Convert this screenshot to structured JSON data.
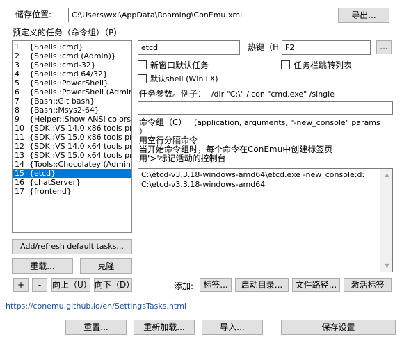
{
  "storage": {
    "label": "储存位置:",
    "path": "C:\\Users\\wxl\\AppData\\Roaming\\ConEmu.xml",
    "export_button": "导出..."
  },
  "tasks_group_label": "预定义的任务（命令组）（P）",
  "task_list": [
    {
      "num": "1",
      "name": "{Shells::cmd}"
    },
    {
      "num": "2",
      "name": "{Shells::cmd (Admin)}"
    },
    {
      "num": "3",
      "name": "{Shells::cmd-32}"
    },
    {
      "num": "4",
      "name": "{Shells::cmd 64/32}"
    },
    {
      "num": "5",
      "name": "{Shells::PowerShell}"
    },
    {
      "num": "6",
      "name": "{Shells::PowerShell (Admin)}"
    },
    {
      "num": "7",
      "name": "{Bash::Git bash}"
    },
    {
      "num": "8",
      "name": "{Bash::Msys2-64}"
    },
    {
      "num": "9",
      "name": "{Helper::Show ANSI colors}"
    },
    {
      "num": "10",
      "name": "{SDK::VS 14.0 x86 tools prompt}"
    },
    {
      "num": "11",
      "name": "{SDK::VS 15.0 x86 tools prompt}"
    },
    {
      "num": "12",
      "name": "{SDK::VS 14.0 x64 tools prompt}"
    },
    {
      "num": "13",
      "name": "{SDK::VS 15.0 x64 tools prompt}"
    },
    {
      "num": "14",
      "name": "{Tools::Chocolatey (Admin)}"
    },
    {
      "num": "15",
      "name": "{etcd}",
      "selected": true
    },
    {
      "num": "16",
      "name": "{chatServer}"
    },
    {
      "num": "17",
      "name": "{frontend}"
    }
  ],
  "left_buttons": {
    "add_refresh": "Add/refresh default tasks...",
    "reload": "重载...",
    "clone": "克隆",
    "plus": "+",
    "minus": "-",
    "up": "向上（U）",
    "down": "向下（D）"
  },
  "task": {
    "name": "etcd",
    "hotkey_label": "热键（H",
    "hotkey_value": "F2",
    "hotkey_button": "...",
    "new_window_default": "新窗口默认任务",
    "taskbar_jump": "任务栏跳转列表",
    "default_shell": "默认shell (WIn+X)",
    "params_label": "任务参数。例子：",
    "params_example": "/dir \"C:\\\" /icon \"cmd.exe\" /single",
    "params_value": "",
    "commands_label": "命令组（C）",
    "commands_hint_1": "（application, arguments, \"-new_console\" params",
    "commands_hint_2": "）",
    "commands_hint_3": "用空行分隔命令",
    "commands_hint_4": "当开始命令组时，每个命令在ConEmu中创建标签页",
    "commands_hint_5": "用'>'标记活动的控制台",
    "commands_value": "C:\\etcd-v3.3.18-windows-amd64\\etcd.exe  -new_console:d:C:\\etcd-v3.3.18-windows-amd64"
  },
  "add_row": {
    "label": "添加:",
    "tab": "标签...",
    "startup_dir": "启动目录...",
    "file_path": "文件路径...",
    "activate_tab": "激活标签"
  },
  "help_link": "https://conemu.github.io/en/SettingsTasks.html",
  "bottom_buttons": {
    "reset": "重置...",
    "reload": "重新加载...",
    "import": "导入...",
    "save": "保存设置"
  }
}
